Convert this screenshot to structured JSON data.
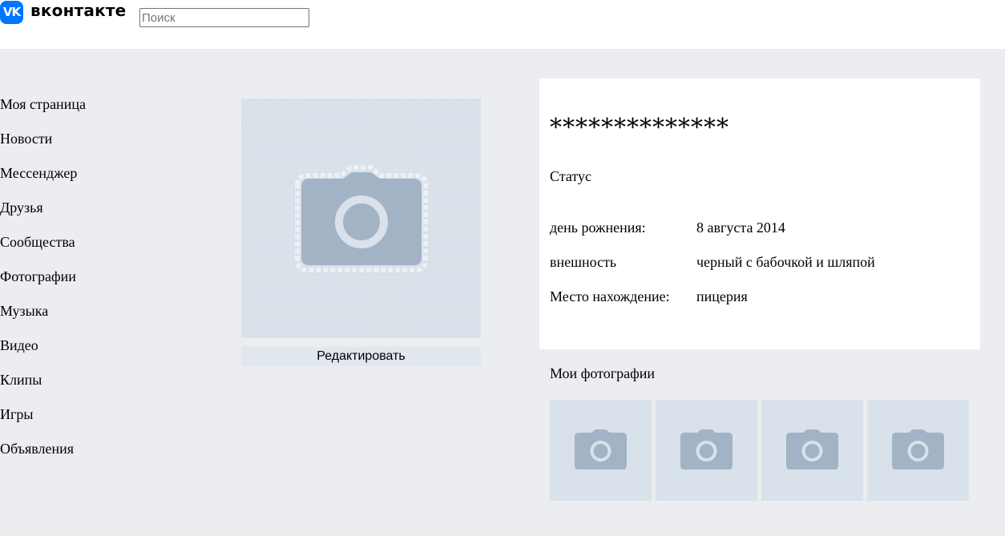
{
  "header": {
    "logo_mark": "VK",
    "logo_text": "вконтакте",
    "search_placeholder": "Поиск"
  },
  "nav": {
    "items": [
      {
        "label": "Моя страница"
      },
      {
        "label": "Новости"
      },
      {
        "label": "Мессенджер"
      },
      {
        "label": "Друзья"
      },
      {
        "label": "Сообщества"
      },
      {
        "label": "Фотографии"
      },
      {
        "label": "Музыка"
      },
      {
        "label": "Видео"
      },
      {
        "label": "Клипы"
      },
      {
        "label": "Игры"
      },
      {
        "label": "Объявления"
      }
    ]
  },
  "avatar": {
    "icon": "camera-icon",
    "edit_label": "Редактировать"
  },
  "profile": {
    "name": "**************",
    "status": "Статус",
    "info": [
      {
        "key": "день рожнения:",
        "value": "8 августа 2014"
      },
      {
        "key": "внешность",
        "value": "черный с бабочкой и шляпой"
      },
      {
        "key": "Место нахождение:",
        "value": "пицерия"
      }
    ]
  },
  "photos": {
    "title": "Мои фотографии",
    "items": [
      {
        "icon": "camera-icon"
      },
      {
        "icon": "camera-icon"
      },
      {
        "icon": "camera-icon"
      },
      {
        "icon": "camera-icon"
      }
    ]
  },
  "colors": {
    "background": "#ebedf0",
    "brand": "#0077ff",
    "placeholder_bg": "#d9e1ea",
    "camera": "#a3b3c6"
  }
}
